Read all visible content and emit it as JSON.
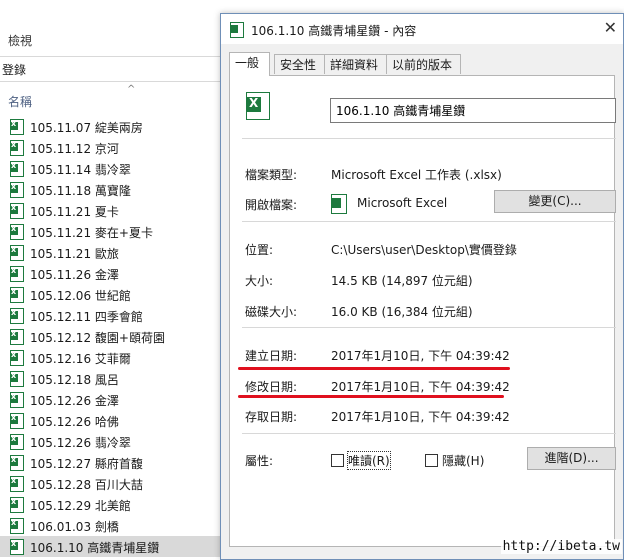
{
  "explorer": {
    "tab_label": "檢視",
    "address_text": "登錄",
    "column_name": "名稱",
    "sort_indicator": "^",
    "files": [
      "105.11.07 綻美兩房",
      "105.11.12 京河",
      "105.11.14 翡冷翠",
      "105.11.18 萬寶隆",
      "105.11.21 夏卡",
      "105.11.21 麥在+夏卡",
      "105.11.21 歐旅",
      "105.11.26 金澤",
      "105.12.06 世紀館",
      "105.12.11 四季會館",
      "105.12.12 馥園+頤荷園",
      "105.12.16 艾菲爾",
      "105.12.18 風呂",
      "105.12.26 金澤",
      "105.12.26 哈佛",
      "105.12.26 翡冷翠",
      "105.12.27 縣府首馥",
      "105.12.28 百川大喆",
      "105.12.29 北美館",
      "106.01.03 劍橋",
      "106.1.10 高鐵青埔星鑽"
    ],
    "selected_index": 20
  },
  "dialog": {
    "title": "106.1.10 高鐵青埔星鑽 - 內容",
    "close_glyph": "✕",
    "tabs": [
      "一般",
      "安全性",
      "詳細資料",
      "以前的版本"
    ],
    "active_tab": 0,
    "file_name": "106.1.10 高鐵青埔星鑽",
    "file_type_label": "檔案類型:",
    "file_type_value": "Microsoft Excel 工作表 (.xlsx)",
    "opens_with_label": "開啟檔案:",
    "opens_with_value": "Microsoft Excel",
    "change_button": "變更(C)...",
    "location_label": "位置:",
    "location_value": "C:\\Users\\user\\Desktop\\實價登錄",
    "size_label": "大小:",
    "size_value": "14.5 KB (14,897 位元組)",
    "disk_size_label": "磁碟大小:",
    "disk_size_value": "16.0 KB (16,384 位元組)",
    "created_label": "建立日期:",
    "created_value": "2017年1月10日, 下午 04:39:42",
    "modified_label": "修改日期:",
    "modified_value": "2017年1月10日, 下午 04:39:42",
    "accessed_label": "存取日期:",
    "accessed_value": "2017年1月10日, 下午 04:39:42",
    "attributes_label": "屬性:",
    "readonly_label": "唯讀(R)",
    "readonly_checked": false,
    "hidden_label": "隱藏(H)",
    "hidden_checked": false,
    "advanced_button": "進階(D)...",
    "highlight_color": "#e0101e"
  },
  "watermark": "http://ibeta.tw",
  "colors": {
    "excel_green": "#1d7a3e",
    "dialog_bg": "#f0f0f0",
    "selection": "#d9d9d9"
  },
  "icons": {
    "excel": "excel-file-icon",
    "close": "close-icon"
  }
}
